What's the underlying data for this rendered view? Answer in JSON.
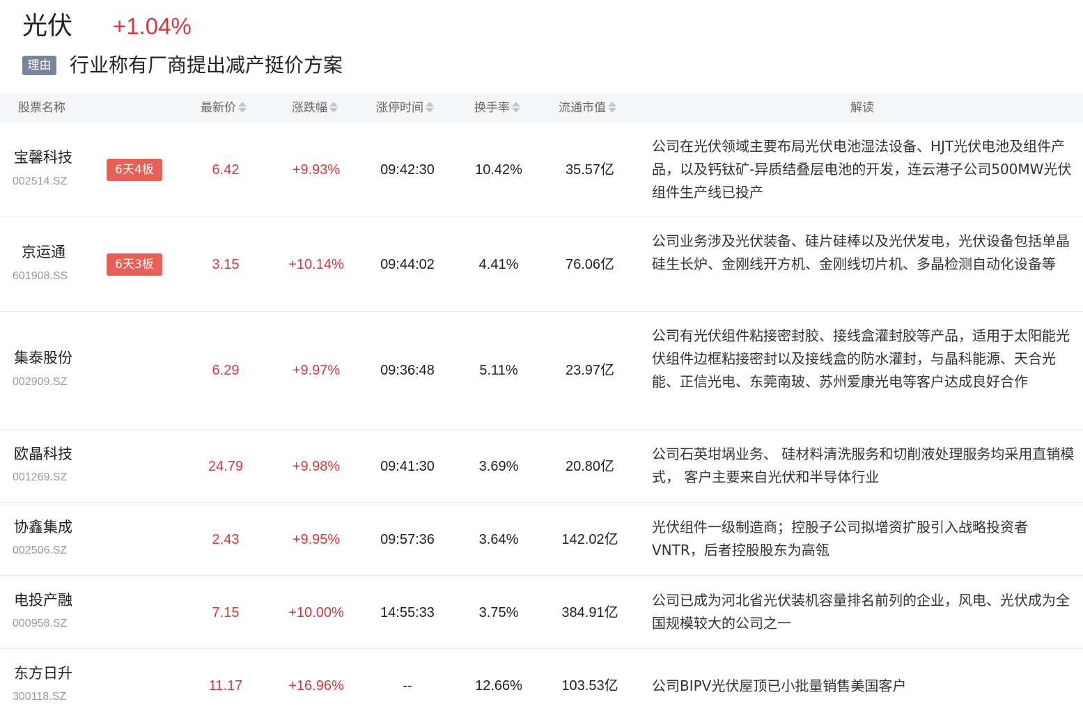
{
  "sector": {
    "name": "光伏",
    "change": "+1.04%",
    "reason_tag": "理由",
    "reason_text": "行业称有厂商提出减产挺价方案"
  },
  "table": {
    "headers": {
      "name": "股票名称",
      "price": "最新价",
      "change": "涨跌幅",
      "limit_time": "涨停时间",
      "turnover": "换手率",
      "market_cap": "流通市值",
      "description": "解读"
    },
    "rows": [
      {
        "name": "宝馨科技",
        "code": "002514.SZ",
        "tag": "6天4板",
        "price": "6.42",
        "change": "+9.93%",
        "time": "09:42:30",
        "turnover": "10.42%",
        "cap": "35.57亿",
        "desc": "公司在光伏领域主要布局光伏电池湿法设备、HJT光伏电池及组件产品，以及钙钛矿-异质结叠层电池的开发，连云港子公司500MW光伏组件生产线已投产"
      },
      {
        "name": "京运通",
        "code": "601908.SS",
        "tag": "6天3板",
        "price": "3.15",
        "change": "+10.14%",
        "time": "09:44:02",
        "turnover": "4.41%",
        "cap": "76.06亿",
        "desc": "公司业务涉及光伏装备、硅片硅棒以及光伏发电，光伏设备包括单晶硅生长炉、金刚线开方机、金刚线切片机、多晶检测自动化设备等"
      },
      {
        "name": "集泰股份",
        "code": "002909.SZ",
        "tag": "",
        "price": "6.29",
        "change": "+9.97%",
        "time": "09:36:48",
        "turnover": "5.11%",
        "cap": "23.97亿",
        "desc": "公司有光伏组件粘接密封胶、接线盒灌封胶等产品，适用于太阳能光伏组件边框粘接密封以及接线盒的防水灌封，与晶科能源、天合光能、正信光电、东莞南玻、苏州爱康光电等客户达成良好合作"
      },
      {
        "name": "欧晶科技",
        "code": "001269.SZ",
        "tag": "",
        "price": "24.79",
        "change": "+9.98%",
        "time": "09:41:30",
        "turnover": "3.69%",
        "cap": "20.80亿",
        "desc": "公司石英坩埚业务、 硅材料清洗服务和切削液处理服务均采用直销模式， 客户主要来自光伏和半导体行业"
      },
      {
        "name": "协鑫集成",
        "code": "002506.SZ",
        "tag": "",
        "price": "2.43",
        "change": "+9.95%",
        "time": "09:57:36",
        "turnover": "3.64%",
        "cap": "142.02亿",
        "desc": "光伏组件一级制造商；控股子公司拟增资扩股引入战略投资者VNTR，后者控股股东为高瓴"
      },
      {
        "name": "电投产融",
        "code": "000958.SZ",
        "tag": "",
        "price": "7.15",
        "change": "+10.00%",
        "time": "14:55:33",
        "turnover": "3.75%",
        "cap": "384.91亿",
        "desc": "公司已成为河北省光伏装机容量排名前列的企业，风电、光伏成为全国规模较大的公司之一"
      },
      {
        "name": "东方日升",
        "code": "300118.SZ",
        "tag": "",
        "price": "11.17",
        "change": "+16.96%",
        "time": "--",
        "turnover": "12.66%",
        "cap": "103.53亿",
        "desc": "公司BIPV光伏屋顶已小批量销售美国客户"
      }
    ]
  }
}
